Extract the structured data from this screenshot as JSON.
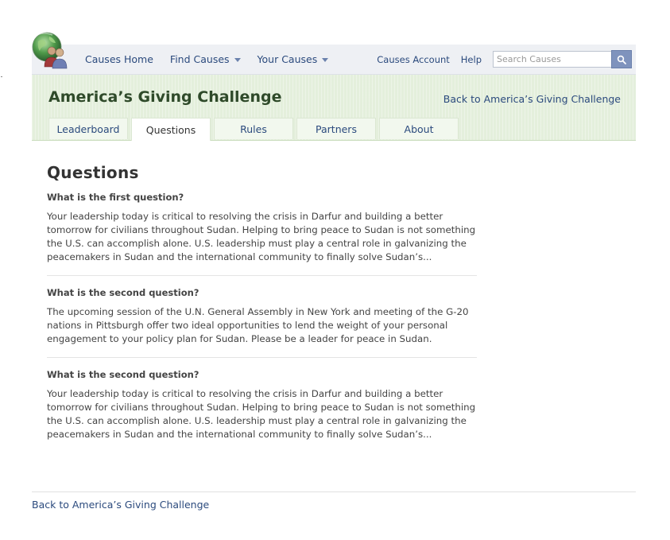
{
  "nav": {
    "items": [
      {
        "label": "Causes Home",
        "dropdown": false
      },
      {
        "label": "Find Causes",
        "dropdown": true
      },
      {
        "label": "Your Causes",
        "dropdown": true
      }
    ],
    "account_label": "Causes Account",
    "help_label": "Help",
    "search": {
      "placeholder": "Search Causes",
      "value": ""
    },
    "logo_icon": "globe-people-logo-icon",
    "search_icon": "search-icon"
  },
  "header": {
    "title": "America’s Giving Challenge",
    "back_link": "Back to America’s Giving Challenge",
    "tabs": [
      {
        "label": "Leaderboard",
        "active": false
      },
      {
        "label": "Questions",
        "active": true
      },
      {
        "label": "Rules",
        "active": false
      },
      {
        "label": "Partners",
        "active": false
      },
      {
        "label": "About",
        "active": false
      }
    ]
  },
  "main": {
    "title": "Questions",
    "questions": [
      {
        "question": "What is the first question?",
        "answer": "Your leadership today is critical to resolving the crisis in Darfur and building a better tomorrow for civilians throughout Sudan. Helping to bring peace to Sudan is not something the U.S. can accomplish alone. U.S. leadership must play a central role in galvanizing the peacemakers in Sudan and the international community to finally solve Sudan’s..."
      },
      {
        "question": "What is the second question?",
        "answer": "The upcoming session of the U.N. General Assembly in New York and meeting of the G-20 nations in Pittsburgh offer two ideal opportunities to lend the weight of your personal engagement to your policy plan for Sudan. Please be a leader for peace in Sudan."
      },
      {
        "question": "What is the second question?",
        "answer": "Your leadership today is critical to resolving the crisis in Darfur and building a better tomorrow for civilians throughout Sudan. Helping to bring peace to Sudan is not something the U.S. can accomplish alone. U.S. leadership must play a central role in galvanizing the peacemakers in Sudan and the international community to finally solve Sudan’s..."
      }
    ]
  },
  "footer": {
    "back_link": "Back to America’s Giving Challenge"
  },
  "colors": {
    "link": "#2b4a7d",
    "header_bg": "#e4efdc",
    "nav_bg": "#eef0f4",
    "search_button": "#7f93bd"
  }
}
